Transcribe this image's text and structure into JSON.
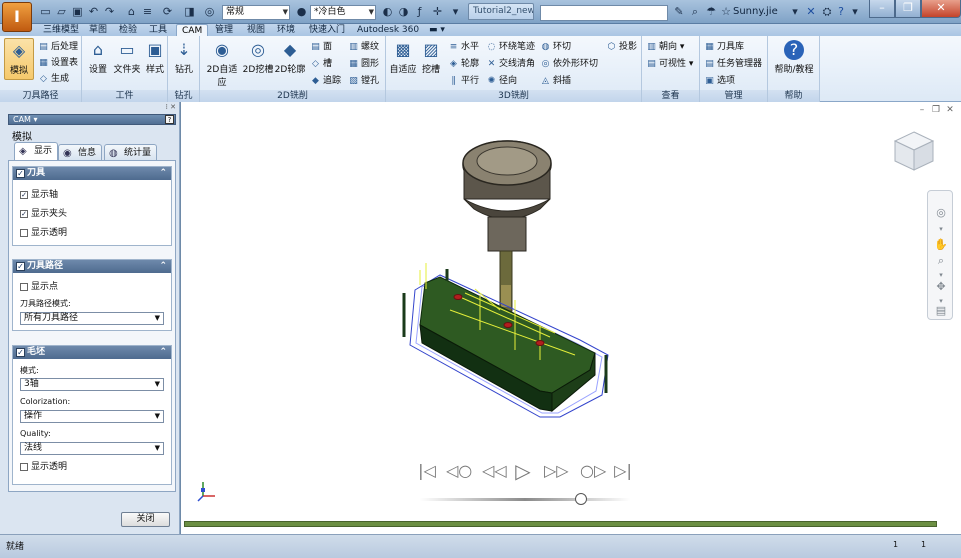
{
  "app": {
    "logo": "I",
    "title": "Tutorial2_new...",
    "user": "Sunny.jie"
  },
  "qat": {
    "style_combo": "常规",
    "material_combo": "*冷白色",
    "help": "?"
  },
  "ribbon_tabs": [
    "三维模型",
    "草图",
    "检验",
    "工具",
    "CAM",
    "管理",
    "视图",
    "环境",
    "快速入门",
    "Autodesk 360"
  ],
  "groups": {
    "toolpath": {
      "label": "刀具路径",
      "simulate": "模拟",
      "post": "后处理",
      "setup_sheet": "设置表",
      "generate": "生成"
    },
    "work": {
      "label": "工件",
      "setup": "设置",
      "folder": "文件夹",
      "pattern": "样式"
    },
    "drill": {
      "label": "钻孔",
      "drill": "钻孔"
    },
    "mill2d": {
      "label": "2D铣削",
      "adaptive": "2D自适应",
      "pocket": "2D挖槽",
      "contour": "2D轮廓",
      "face": "面",
      "slot": "槽",
      "trace": "追踪",
      "thread": "螺纹",
      "circular": "圆形",
      "bore": "镗孔"
    },
    "mill3d": {
      "label": "3D铣削",
      "adaptive": "自适应",
      "pocket": "挖槽",
      "horizontal": "水平",
      "contour": "轮廓",
      "parallel": "平行",
      "pencil": "环绕笔迹",
      "scallop": "交线清角",
      "radial": "径向",
      "spiral": "环切",
      "morphed": "依外形环切",
      "ramp": "斜插",
      "project": "投影"
    },
    "view": {
      "label": "查看",
      "orient": "朝向",
      "visibility": "可视性"
    },
    "manage": {
      "label": "管理",
      "tool_library": "刀具库",
      "task_manager": "任务管理器",
      "options": "选项"
    },
    "help": {
      "label": "帮助",
      "tutorial": "帮助/教程"
    }
  },
  "panel": {
    "header": "CAM ▾",
    "title": "模拟",
    "tabs": [
      "显示",
      "信息",
      "统计量"
    ],
    "tool": {
      "header": "刀具",
      "show_shaft": "显示轴",
      "show_holder": "显示夹头",
      "show_transparent": "显示透明"
    },
    "toolpath": {
      "header": "刀具路径",
      "show_points": "显示点",
      "mode_label": "刀具路径模式:",
      "mode_value": "所有刀具路径"
    },
    "stock": {
      "header": "毛坯",
      "mode_label": "模式:",
      "mode_value": "3轴",
      "colorization_label": "Colorization:",
      "colorization_value": "操作",
      "quality_label": "Quality:",
      "quality_value": "法线",
      "show_transparent": "显示透明"
    },
    "close": "关闭"
  },
  "status": {
    "text": "就绪",
    "count1": "1",
    "count2": "1"
  },
  "icons": {
    "play": "play-icon",
    "first": "skip-first-icon",
    "last": "skip-last-icon"
  },
  "colors": {
    "stock": "#1e4a1e",
    "timeline": "#6c8f43",
    "accent": "#f6c96c"
  }
}
